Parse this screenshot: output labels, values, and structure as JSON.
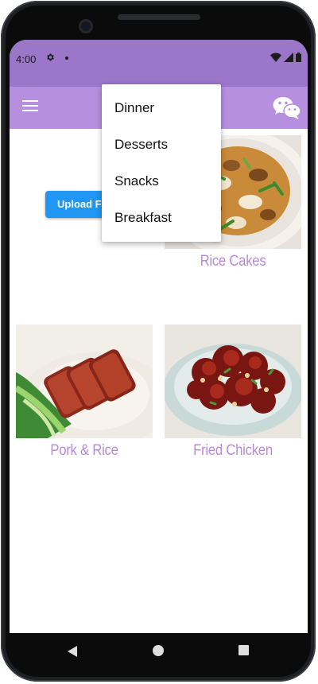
{
  "status": {
    "time": "4:00"
  },
  "dropdown": {
    "items": [
      "Dinner",
      "Desserts",
      "Snacks",
      "Breakfast"
    ]
  },
  "upload_button": {
    "label": "Upload File"
  },
  "foods": [
    {
      "label": "Rice Cakes"
    },
    {
      "label": "Pork & Rice"
    },
    {
      "label": "Fried Chicken"
    }
  ],
  "colors": {
    "status_bar": "#9b76c9",
    "app_bar": "#b78fdf",
    "upload_button": "#2196f3",
    "food_label": "#b98ad8"
  },
  "icons": {
    "menu": "menu-icon",
    "chat": "wechat-icon",
    "settings": "gear-icon",
    "wifi": "wifi-icon",
    "signal": "signal-icon",
    "battery": "battery-icon",
    "back": "back-icon",
    "home": "home-icon",
    "recents": "recents-icon"
  }
}
